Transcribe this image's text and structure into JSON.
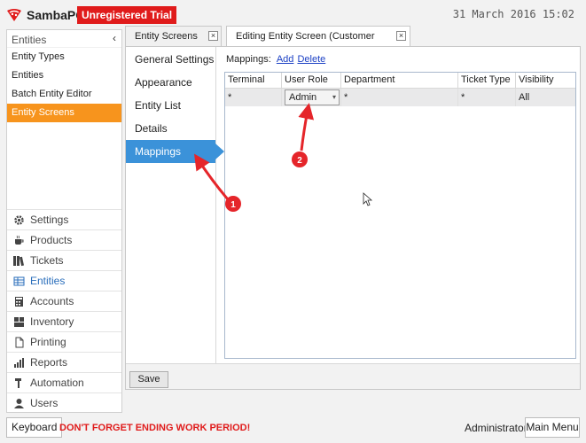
{
  "header": {
    "app_name": "SambaPOS",
    "trial_label": "Unregistered Trial",
    "datetime": "31 March 2016 15:02"
  },
  "sidebar": {
    "section_title": "Entities",
    "collapse_glyph": "‹",
    "sub_items": [
      {
        "label": "Entity Types",
        "active": false
      },
      {
        "label": "Entities",
        "active": false
      },
      {
        "label": "Batch Entity Editor",
        "active": false
      },
      {
        "label": "Entity Screens",
        "active": true
      }
    ],
    "nav_items": [
      {
        "label": "Settings",
        "icon": "gear-icon"
      },
      {
        "label": "Products",
        "icon": "coffee-cup-icon"
      },
      {
        "label": "Tickets",
        "icon": "books-icon"
      },
      {
        "label": "Entities",
        "icon": "table-icon",
        "selected": true
      },
      {
        "label": "Accounts",
        "icon": "calculator-icon"
      },
      {
        "label": "Inventory",
        "icon": "inventory-icon"
      },
      {
        "label": "Printing",
        "icon": "document-icon"
      },
      {
        "label": "Reports",
        "icon": "bar-chart-icon"
      },
      {
        "label": "Automation",
        "icon": "hammer-icon"
      },
      {
        "label": "Users",
        "icon": "user-icon"
      }
    ]
  },
  "tabs": [
    {
      "label": "Entity Screens",
      "active": false
    },
    {
      "label": "Editing Entity Screen (Customer Search)",
      "active": true
    }
  ],
  "settings_menu": [
    {
      "label": "General Settings",
      "active": false
    },
    {
      "label": "Appearance",
      "active": false
    },
    {
      "label": "Entity List",
      "active": false
    },
    {
      "label": "Details",
      "active": false
    },
    {
      "label": "Mappings",
      "active": true
    }
  ],
  "mappings": {
    "label": "Mappings:",
    "add_label": "Add",
    "delete_label": "Delete",
    "columns": [
      "Terminal",
      "User Role",
      "Department",
      "Ticket Type",
      "Visibility"
    ],
    "rows": [
      {
        "terminal": "*",
        "user_role": "Admin",
        "department": "*",
        "ticket_type": "*",
        "visibility": "All"
      }
    ]
  },
  "save_label": "Save",
  "footer": {
    "keyboard_label": "Keyboard",
    "warning": "DON'T FORGET ENDING WORK PERIOD!",
    "user": "Administrator",
    "main_menu_label": "Main Menu"
  },
  "annotations": {
    "badge_1": "1",
    "badge_2": "2",
    "color": "#e5252a"
  }
}
